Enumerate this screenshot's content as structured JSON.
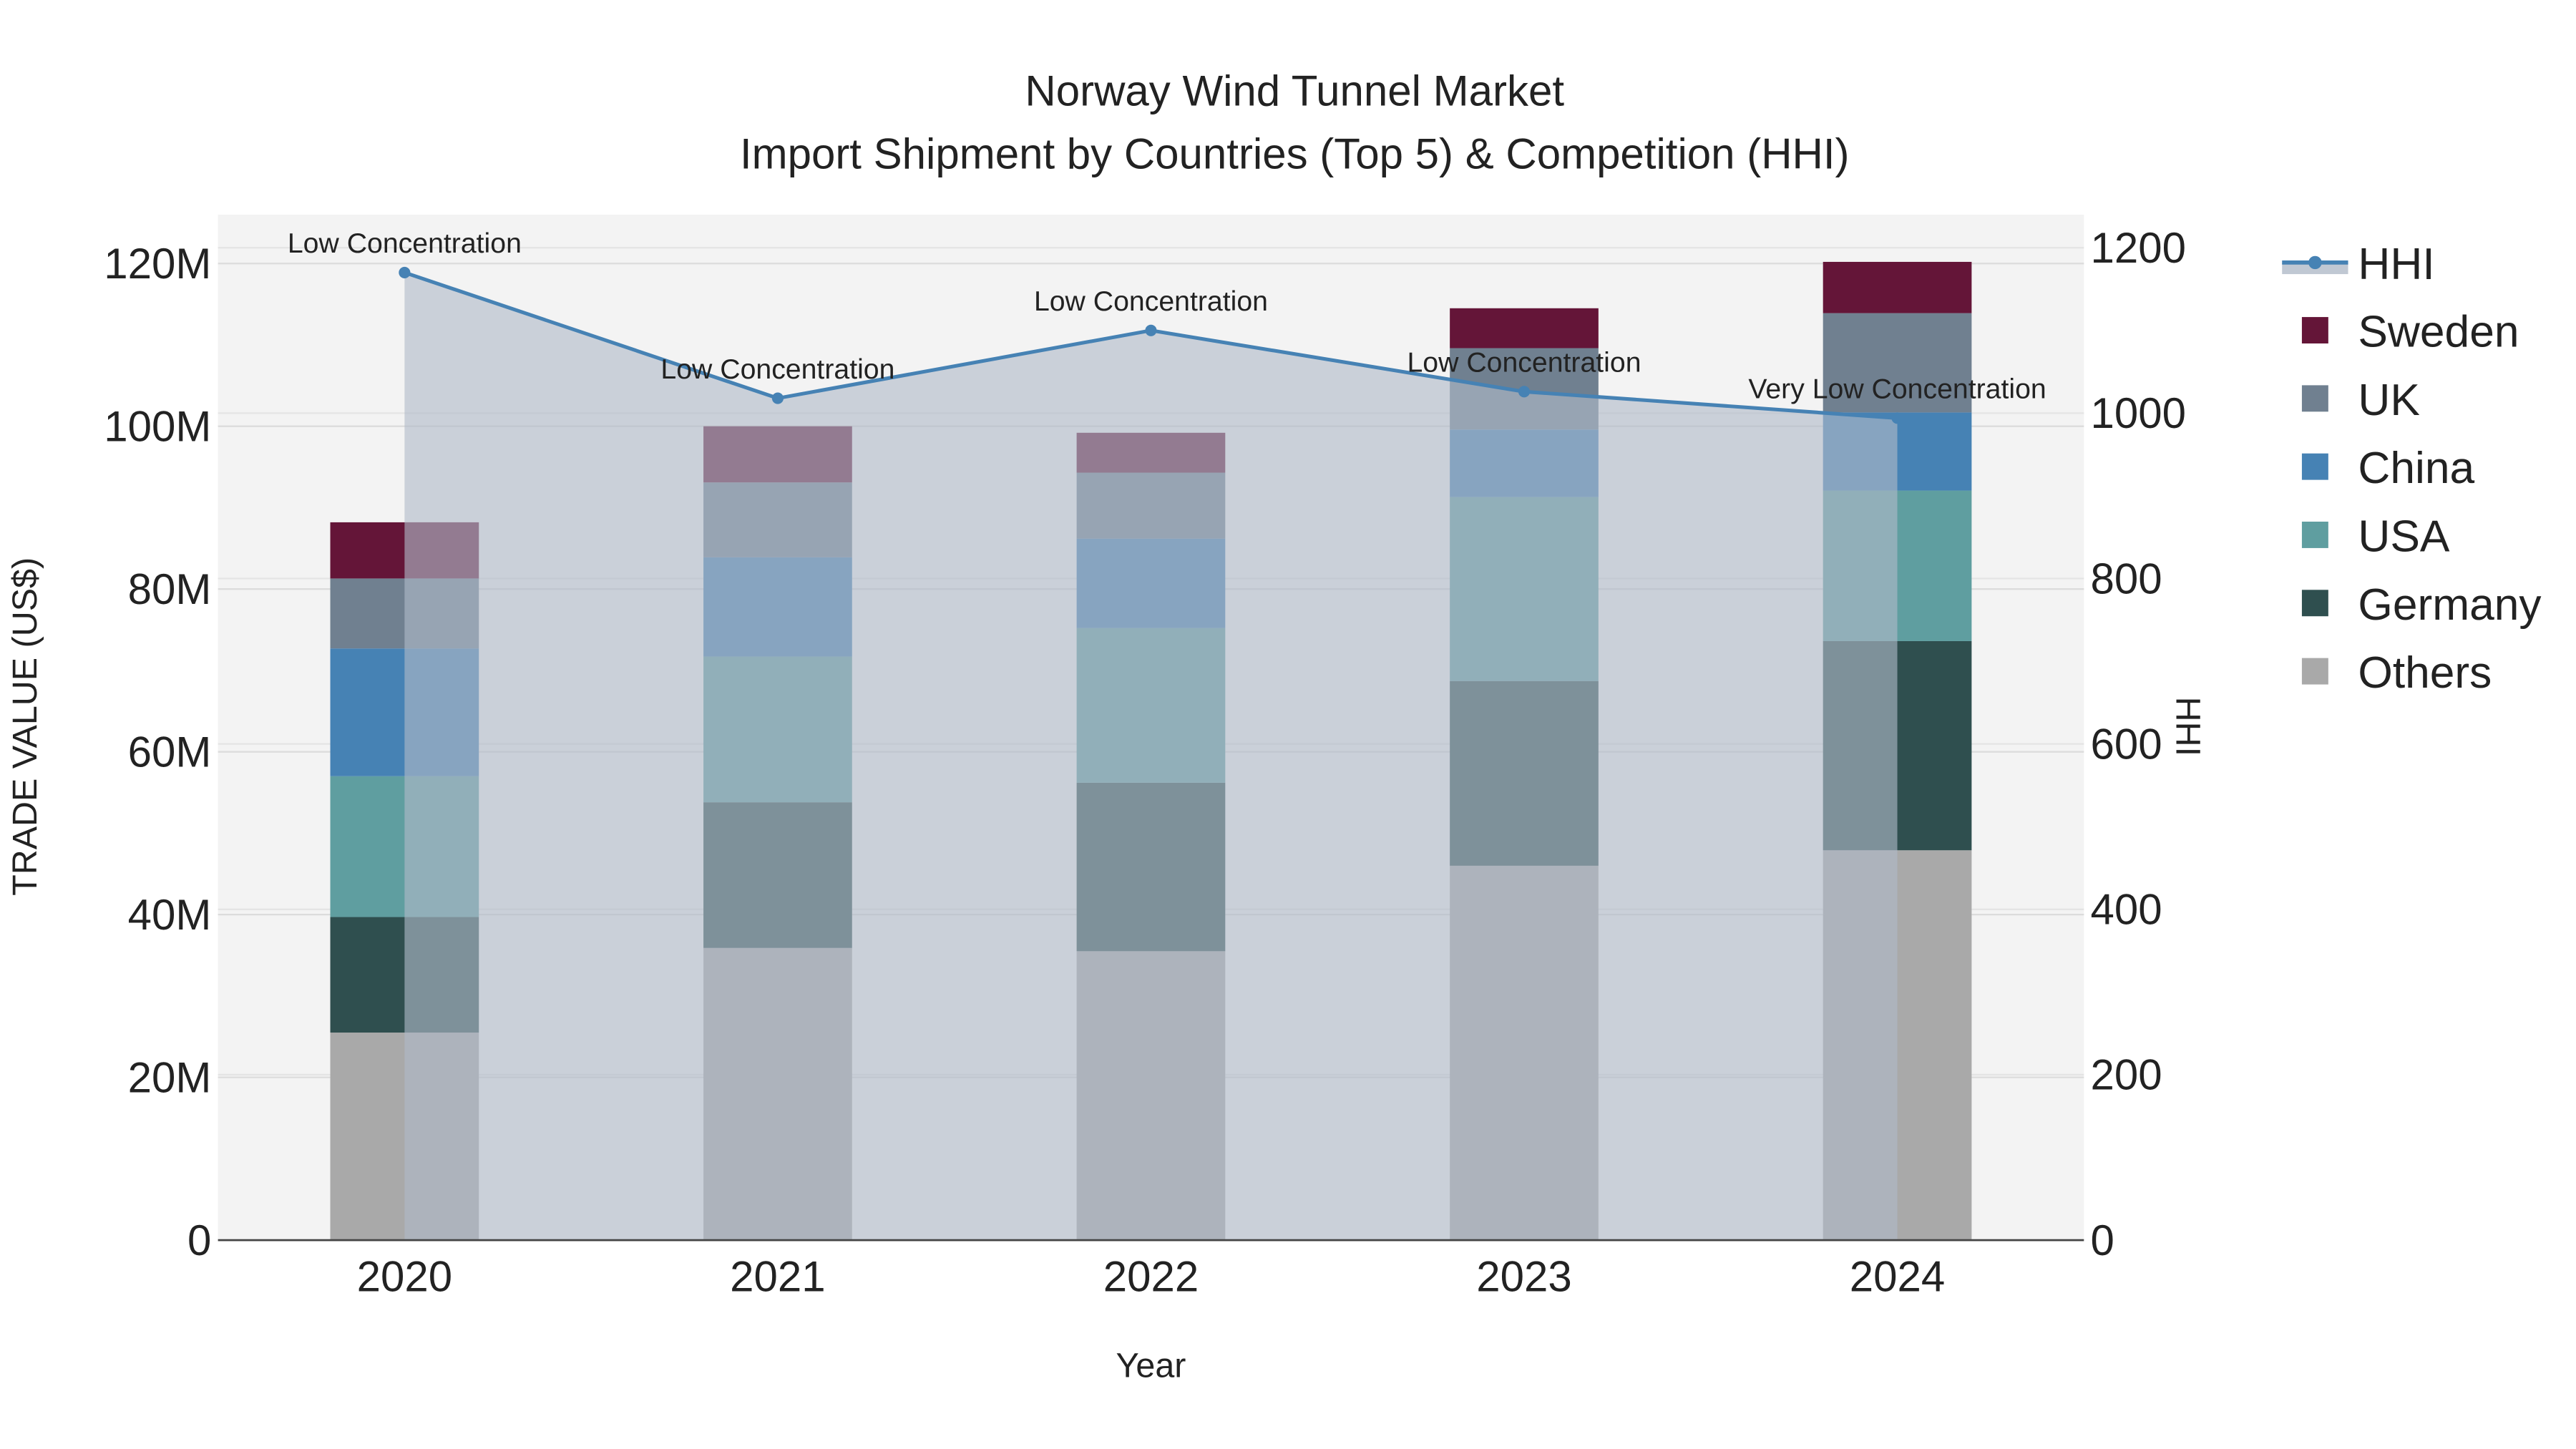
{
  "chart_data": {
    "type": "bar",
    "title": "Norway Wind Tunnel Market",
    "subtitle": "Import Shipment by Countries (Top 5) & Competition (HHI)",
    "xlabel": "Year",
    "ylabel": "TRADE VALUE (US$)",
    "y2label": "HHI",
    "categories": [
      "2020",
      "2021",
      "2022",
      "2023",
      "2024"
    ],
    "ylim": [
      0,
      126
    ],
    "y2lim": [
      0,
      1240
    ],
    "yticks": [
      {
        "v": 0,
        "label": "0"
      },
      {
        "v": 20,
        "label": "20M"
      },
      {
        "v": 40,
        "label": "40M"
      },
      {
        "v": 60,
        "label": "60M"
      },
      {
        "v": 80,
        "label": "80M"
      },
      {
        "v": 100,
        "label": "100M"
      },
      {
        "v": 120,
        "label": "120M"
      }
    ],
    "y2ticks": [
      {
        "v": 0,
        "label": "0"
      },
      {
        "v": 200,
        "label": "200"
      },
      {
        "v": 400,
        "label": "400"
      },
      {
        "v": 600,
        "label": "600"
      },
      {
        "v": 800,
        "label": "800"
      },
      {
        "v": 1000,
        "label": "1000"
      },
      {
        "v": 1200,
        "label": "1200"
      }
    ],
    "value_unit": "million US$",
    "series": [
      {
        "name": "Others",
        "color": "#a9a9a9",
        "values": [
          25.5,
          35.9,
          35.5,
          46.0,
          47.9
        ]
      },
      {
        "name": "Germany",
        "color": "#2f4f4f",
        "values": [
          14.2,
          17.9,
          20.7,
          22.7,
          25.7
        ]
      },
      {
        "name": "USA",
        "color": "#5f9ea0",
        "values": [
          17.3,
          17.9,
          19.0,
          22.6,
          18.5
        ]
      },
      {
        "name": "China",
        "color": "#4682b4",
        "values": [
          15.7,
          12.2,
          11.0,
          8.3,
          9.6
        ]
      },
      {
        "name": "UK",
        "color": "#708090",
        "values": [
          8.6,
          9.2,
          8.1,
          10.0,
          12.2
        ]
      },
      {
        "name": "Sweden",
        "color": "#641538",
        "values": [
          6.9,
          6.9,
          4.9,
          4.9,
          6.3
        ]
      }
    ],
    "hhi": {
      "name": "HHI",
      "color": "#4682b4",
      "values": [
        1170,
        1018,
        1100,
        1026,
        994
      ],
      "annotations": [
        "Low Concentration",
        "Low Concentration",
        "Low Concentration",
        "Low Concentration",
        "Very Low Concentration"
      ]
    },
    "legend": {
      "placement": "right",
      "order": [
        "HHI",
        "Sweden",
        "UK",
        "China",
        "USA",
        "Germany",
        "Others"
      ]
    },
    "grid": true
  }
}
